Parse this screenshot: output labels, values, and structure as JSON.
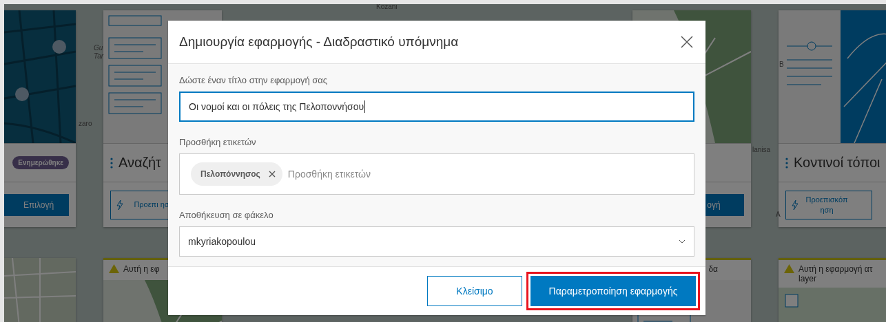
{
  "map_labels": [
    {
      "text": "Kozani",
      "kind": "top"
    },
    {
      "text": "Gu",
      "kind": "gu"
    },
    {
      "text": "Tar",
      "kind": "tar"
    },
    {
      "text": "zaro",
      "kind": "zaro"
    },
    {
      "text": "lanisa",
      "kind": "lanisa"
    },
    {
      "text": "B",
      "kind": "b"
    },
    {
      "text": "A",
      "kind": "a"
    }
  ],
  "cards": [
    {
      "kind": "city-map",
      "badge": "Ενημερώθηκε",
      "primary_button": "Επιλογή"
    },
    {
      "kind": "list",
      "title": "Αναζήτ",
      "preview_button": "Προεπι ησ"
    },
    {
      "kind": "park-map",
      "primary_button": "ογή"
    },
    {
      "kind": "slider-list",
      "title": "Κοντινοί τόποι",
      "preview_button": "Προεπισκόπ ηση"
    }
  ],
  "lower_cards": [
    {
      "kind": "street-map"
    },
    {
      "kind": "park-map",
      "warning_icon": true,
      "warning": "Αυτή η εφ"
    },
    {
      "kind": "list",
      "warning_icon": false,
      "warning": "δα"
    },
    {
      "kind": "check-map",
      "warning_icon": true,
      "warning": "Αυτή η εφαρμογή ατ layer"
    }
  ],
  "dialog": {
    "title": "Δημιουργία εφαρμογής - Διαδραστικό υπόμνημα",
    "title_field": {
      "label": "Δώστε έναν τίτλο στην εφαρμογή σας",
      "value": "Οι νομοί και οι πόλεις της Πελοποννήσου",
      "focused": true
    },
    "tags_field": {
      "label": "Προσθήκη ετικετών",
      "tags": [
        "Πελοπόννησος"
      ],
      "placeholder": "Προσθήκη ετικετών"
    },
    "folder_field": {
      "label": "Αποθήκευση σε φάκελο",
      "value": "mkyriakopoulou"
    },
    "buttons": [
      {
        "label": "Κλείσιμο",
        "kind": "secondary",
        "highlighted": false
      },
      {
        "label": "Παραμετροποίηση εφαρμογής",
        "kind": "primary",
        "highlighted": true
      }
    ]
  }
}
